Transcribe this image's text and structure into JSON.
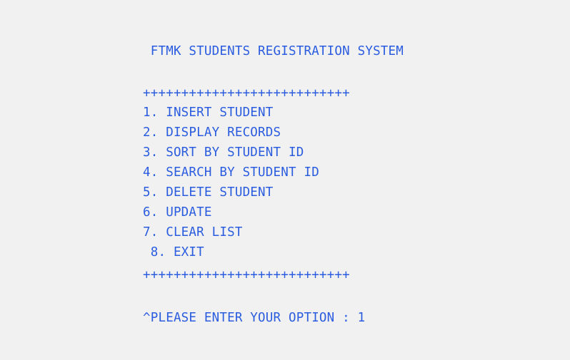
{
  "console": {
    "title": " FTMK STUDENTS REGISTRATION SYSTEM",
    "divider_top": "+++++++++++++++++++++++++++",
    "menu": [
      "1. INSERT STUDENT",
      "2. DISPLAY RECORDS",
      "3. SORT BY STUDENT ID",
      "4. SEARCH BY STUDENT ID",
      "5. DELETE STUDENT",
      "6. UPDATE",
      "7. CLEAR LIST",
      " 8. EXIT"
    ],
    "divider_bottom": "+++++++++++++++++++++++++++",
    "prompt_label": "^PLEASE ENTER YOUR OPTION : ",
    "prompt_value": "1"
  },
  "colors": {
    "background": "#f1f1f1",
    "text": "#2a5ce0"
  }
}
